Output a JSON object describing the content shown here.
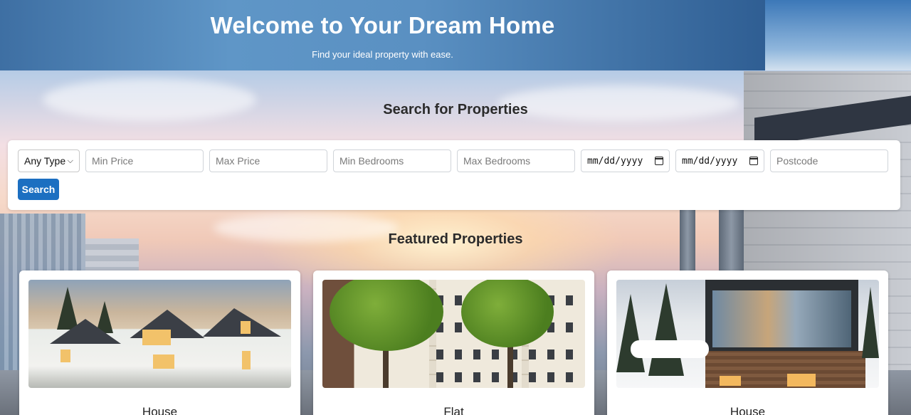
{
  "header": {
    "title": "Welcome to Your Dream Home",
    "subtitle": "Find your ideal property with ease."
  },
  "search": {
    "title": "Search for Properties",
    "type_select": {
      "selected": "Any Type"
    },
    "min_price_placeholder": "Min Price",
    "max_price_placeholder": "Max Price",
    "min_bedrooms_placeholder": "Min Bedrooms",
    "max_bedrooms_placeholder": "Max Bedrooms",
    "date_from": "mm/dd/yyyy",
    "date_to": "mm/dd/yyyy",
    "postcode_placeholder": "Postcode",
    "button_label": "Search"
  },
  "featured": {
    "title": "Featured Properties",
    "cards": [
      {
        "type": "House"
      },
      {
        "type": "Flat"
      },
      {
        "type": "House"
      }
    ]
  },
  "colors": {
    "primary_button": "#1c6fc1",
    "header_blue": "#5a90c2"
  }
}
